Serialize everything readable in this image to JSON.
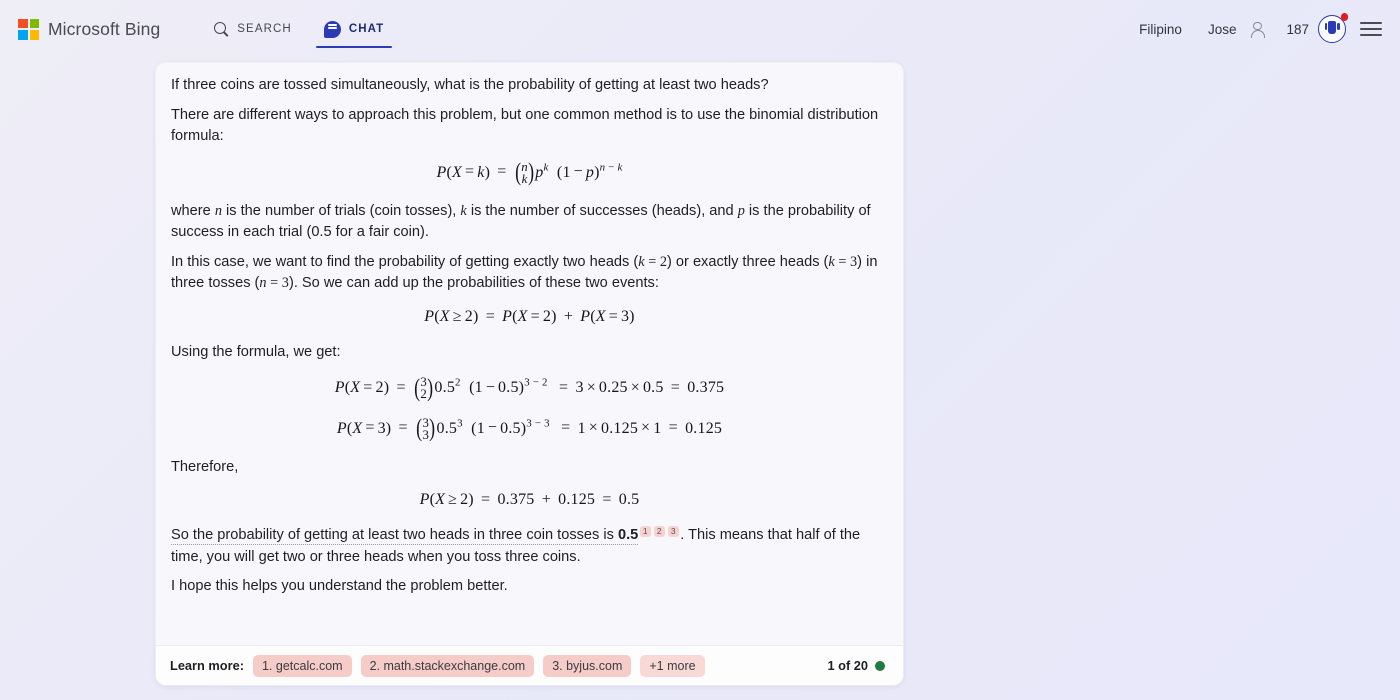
{
  "header": {
    "brand": "Microsoft Bing",
    "logo_icon": "microsoft-squares-icon",
    "tabs": [
      {
        "label": "SEARCH",
        "icon": "search-icon",
        "active": false
      },
      {
        "label": "CHAT",
        "icon": "chat-bubble-icon",
        "active": true
      }
    ],
    "language": "Filipino",
    "account_name": "Jose",
    "account_icon": "person-icon",
    "points": "187",
    "rewards_icon": "rewards-medal-icon",
    "rewards_has_notification": true,
    "menu_icon": "hamburger-menu-icon",
    "colors": {
      "accent_blue": "#2b3ab5",
      "notification_red": "#e01b24"
    }
  },
  "chat": {
    "question": "If three coins are tossed simultaneously, what is the probability of getting at least two heads?",
    "intro": "There are different ways to approach this problem, but one common method is to use the binomial distribution formula:",
    "equation_1": "P(X = k) = (n k) p^k (1 − p)^(n − k)",
    "where_text_parts": {
      "p1": "where ",
      "n": "n",
      "p2": " is the number of trials (coin tosses), ",
      "k": "k",
      "p3": " is the number of successes (heads), and ",
      "p": "p",
      "p4": " is the probability of success in each trial (0.5 for a fair coin)."
    },
    "case_text_parts": {
      "p1": "In this case, we want to find the probability of getting exactly two heads (",
      "k2": "k",
      "eq2": " = 2",
      "p2": ") or exactly three heads (",
      "k3": "k",
      "eq3": " = 3",
      "p3": ") in three tosses (",
      "n3": "n",
      "eqn3": " = 3",
      "p4": "). So we can add up the probabilities of these two events:"
    },
    "equation_2": "P(X ≥ 2) = P(X = 2) + P(X = 3)",
    "using_formula": "Using the formula, we get:",
    "equation_3": "P(X = 2) = (3 2) 0.5^2 (1 − 0.5)^(3 − 2) = 3 × 0.25 × 0.5 = 0.375",
    "equation_4": "P(X = 3) = (3 3) 0.5^3 (1 − 0.5)^(3 − 3) = 1 × 0.125 × 1 = 0.125",
    "therefore": "Therefore,",
    "equation_5": "P(X ≥ 2) = 0.375 + 0.125 = 0.5",
    "conclusion_parts": {
      "cited": "So the probability of getting at least two heads in three coin tosses is ",
      "value": "0.5",
      "citations": [
        "1",
        "2",
        "3"
      ],
      "rest": ". This means that half of the time, you will get two or three heads when you toss three coins."
    },
    "closing": "I hope this helps you understand the problem better."
  },
  "footer": {
    "learn_more_label": "Learn more:",
    "sources": [
      "1. getcalc.com",
      "2. math.stackexchange.com",
      "3. byjus.com"
    ],
    "more_label": "+1 more",
    "pager_text": "1 of 20",
    "pager_dot_color": "#1f7a3d"
  }
}
